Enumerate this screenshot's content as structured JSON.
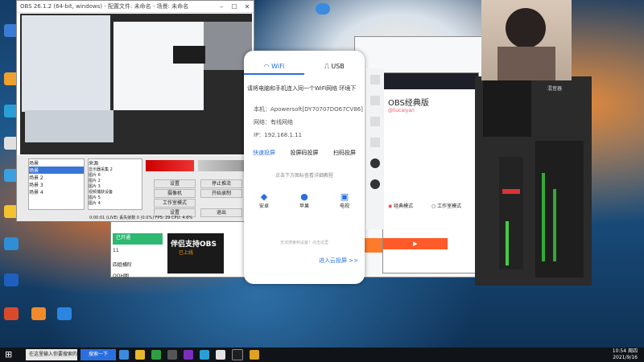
{
  "obs": {
    "title": "OBS 26.1.2 (64-bit, windows) - 配置文件: 未命名 - 场景: 未命名",
    "scenes_header": "场景",
    "scenes": [
      "场景",
      "场景 2",
      "场景 3",
      "场景 4"
    ],
    "sources_header": "来源",
    "sources": [
      "显示器采集 2",
      "图片 6",
      "图片 2",
      "图片 3",
      "视频捕获设备",
      "图片 5",
      "图片 4",
      "图片 1",
      "文本"
    ],
    "controls": [
      "设置",
      "停止推流",
      "摄像机",
      "开始录制",
      "工作室模式",
      "设置",
      "退出"
    ],
    "status": "0:00:01 (LIVE)   丢失帧数 0 (0.0%)   FPS: 29   CPU: 4.6%"
  },
  "phone": {
    "tab_wifi": "WiFi",
    "tab_usb": "USB",
    "instruction": "请将电脑和手机连入同一个WiFi网络 环境下",
    "host_label": "本机：",
    "host_value": "Apowersoft[DY70707DO67CV86]",
    "network_label": "网络：",
    "network_value": "有线网络",
    "ip_label": "IP：",
    "ip_value": "192.168.1.11",
    "mode_tabs": [
      "快速投屏",
      "投屏码投屏",
      "扫码投屏"
    ],
    "hint": "点击下方图标查看详细教程",
    "platforms": [
      "安卓",
      "苹果",
      "电视"
    ],
    "footer_note": "无法搜索到设备？点击这里",
    "enter_cloud": "进入云投屏 >>"
  },
  "obs_popup": {
    "title": "OBS经典版",
    "subtitle": "@liucaiyan",
    "radio1": "经典模式",
    "radio2": "工作室模式"
  },
  "promo": {
    "banner": "伴侣支持OBS",
    "sub": "已上线",
    "menu": [
      "已开通",
      "11",
      "四姐横阶",
      "OOH图"
    ]
  },
  "taskbar": {
    "search_placeholder": "在这里输入你要搜索的内容",
    "app_label": "搜索一下",
    "time": "10:54",
    "date": "2021/9/16",
    "day": "周四"
  },
  "mixer": {
    "labels": [
      "混音器",
      "音频",
      "场景",
      "来源"
    ]
  }
}
